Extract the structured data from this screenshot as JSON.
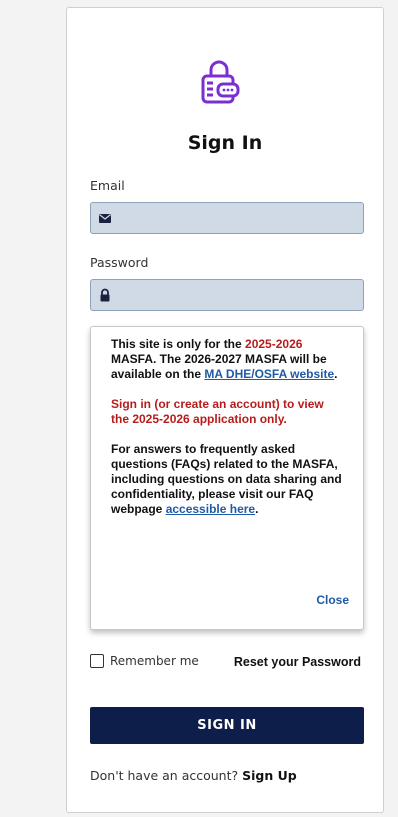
{
  "colors": {
    "primary_button": "#0e1e4a",
    "field_fill": "#cfdae6",
    "alert_red": "#b71c1c",
    "link_blue": "#1f5aa6",
    "logo_purple": "#7b2fd0"
  },
  "icons": {
    "logo": "lock-wallet-icon",
    "email": "envelope-icon",
    "password": "lock-icon"
  },
  "title": "Sign In",
  "email": {
    "label": "Email",
    "value": ""
  },
  "password": {
    "label": "Password",
    "value": ""
  },
  "notice": {
    "p1_a": "This site is only for the ",
    "p1_year": "2025-2026",
    "p1_b": " MASFA.  The 2026-2027 MASFA will be available on the ",
    "p1_link": "MA DHE/OSFA website",
    "p1_c": ".",
    "p2": "Sign in (or create an account) to view the 2025-2026 application only.",
    "p3_a": "For answers to frequently asked questions (FAQs) related to the MASFA, including questions on data sharing and confidentiality, please visit our FAQ webpage ",
    "p3_link": "accessible here",
    "p3_b": ".",
    "close": "Close"
  },
  "remember_label": "Remember me",
  "reset_label": "Reset your Password",
  "signin_label": "SIGN IN",
  "signup_prompt": "Don't have an account?",
  "signup_link": "Sign Up"
}
